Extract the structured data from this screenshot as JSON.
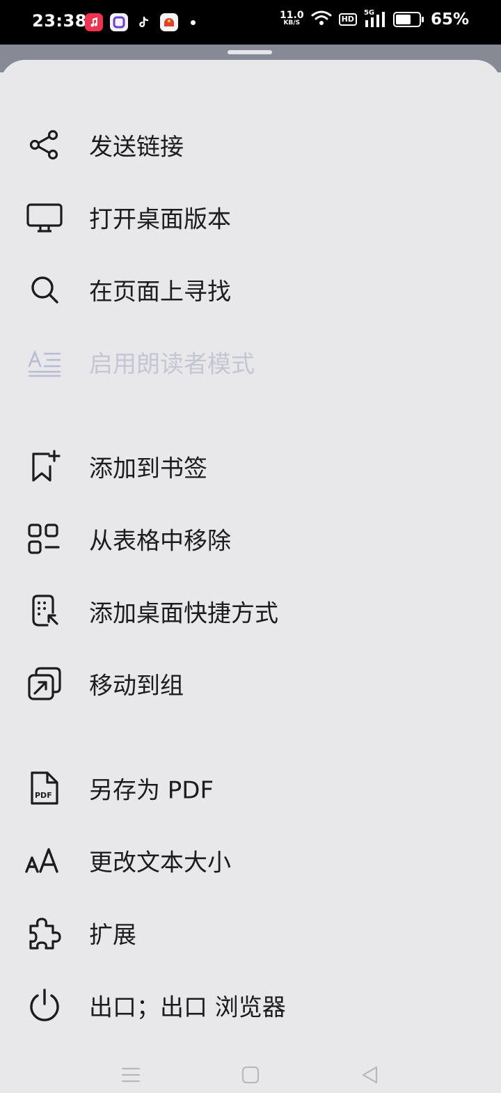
{
  "status_bar": {
    "time": "23:38",
    "net_speed_value": "11.0",
    "net_speed_unit": "KB/S",
    "hd_badge": "HD",
    "network_type": "5G",
    "battery_percent": "65%",
    "battery_level": 0.65
  },
  "menu": {
    "items": [
      {
        "label": "发送链接",
        "icon": "share-icon",
        "enabled": true
      },
      {
        "label": "打开桌面版本",
        "icon": "desktop-icon",
        "enabled": true
      },
      {
        "label": "在页面上寻找",
        "icon": "search-icon",
        "enabled": true
      },
      {
        "label": "启用朗读者模式",
        "icon": "reader-mode-icon",
        "enabled": false
      },
      {
        "label": "添加到书签",
        "icon": "bookmark-add-icon",
        "enabled": true
      },
      {
        "label": "从表格中移除",
        "icon": "grid-remove-icon",
        "enabled": true
      },
      {
        "label": "添加桌面快捷方式",
        "icon": "shortcut-icon",
        "enabled": true
      },
      {
        "label": "移动到组",
        "icon": "move-to-group-icon",
        "enabled": true
      },
      {
        "label": "另存为 PDF",
        "icon": "pdf-icon",
        "enabled": true
      },
      {
        "label": "更改文本大小",
        "icon": "text-size-icon",
        "enabled": true
      },
      {
        "label": "扩展",
        "icon": "extension-icon",
        "enabled": true
      },
      {
        "label": "出口；出口 浏览器",
        "icon": "power-icon",
        "enabled": true
      }
    ]
  },
  "icons": {
    "pdf_icon_text": "PDF"
  },
  "colors": {
    "sheet_background": "#e8e8ea",
    "text": "#1c1c1e",
    "disabled_text": "#c5c6d4",
    "disabled_icon": "#b9bbd4"
  }
}
